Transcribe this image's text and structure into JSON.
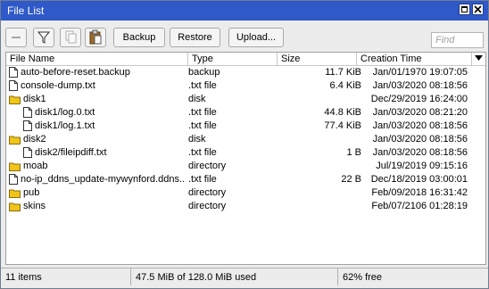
{
  "window": {
    "title": "File List"
  },
  "toolbar": {
    "backup_label": "Backup",
    "restore_label": "Restore",
    "upload_label": "Upload...",
    "find_placeholder": "Find"
  },
  "columns": [
    "File Name",
    "Type",
    "Size",
    "Creation Time"
  ],
  "rows": [
    {
      "name": "auto-before-reset.backup",
      "type": "backup",
      "size": "11.7 KiB",
      "time": "Jan/01/1970 19:07:05",
      "icon": "file-icon",
      "indent": false
    },
    {
      "name": "console-dump.txt",
      "type": ".txt file",
      "size": "6.4 KiB",
      "time": "Jan/03/2020 08:18:56",
      "icon": "file-icon",
      "indent": false
    },
    {
      "name": "disk1",
      "type": "disk",
      "size": "",
      "time": "Dec/29/2019 16:24:00",
      "icon": "folder-icon",
      "indent": false
    },
    {
      "name": "disk1/log.0.txt",
      "type": ".txt file",
      "size": "44.8 KiB",
      "time": "Jan/03/2020 08:21:20",
      "icon": "file-icon",
      "indent": true
    },
    {
      "name": "disk1/log.1.txt",
      "type": ".txt file",
      "size": "77.4 KiB",
      "time": "Jan/03/2020 08:18:56",
      "icon": "file-icon",
      "indent": true
    },
    {
      "name": "disk2",
      "type": "disk",
      "size": "",
      "time": "Jan/03/2020 08:18:56",
      "icon": "folder-icon",
      "indent": false
    },
    {
      "name": "disk2/fileipdiff.txt",
      "type": ".txt file",
      "size": "1 B",
      "time": "Jan/03/2020 08:18:56",
      "icon": "file-icon",
      "indent": true
    },
    {
      "name": "moab",
      "type": "directory",
      "size": "",
      "time": "Jul/19/2019 09:15:16",
      "icon": "folder-icon",
      "indent": false
    },
    {
      "name": "no-ip_ddns_update-mywynford.ddns...",
      "type": ".txt file",
      "size": "22 B",
      "time": "Dec/18/2019 03:00:01",
      "icon": "file-icon",
      "indent": false
    },
    {
      "name": "pub",
      "type": "directory",
      "size": "",
      "time": "Feb/09/2018 16:31:42",
      "icon": "folder-icon",
      "indent": false
    },
    {
      "name": "skins",
      "type": "directory",
      "size": "",
      "time": "Feb/07/2106 01:28:19",
      "icon": "folder-icon",
      "indent": false
    }
  ],
  "status": {
    "items": "11 items",
    "usage": "47.5 MiB of 128.0 MiB used",
    "free": "62% free"
  }
}
